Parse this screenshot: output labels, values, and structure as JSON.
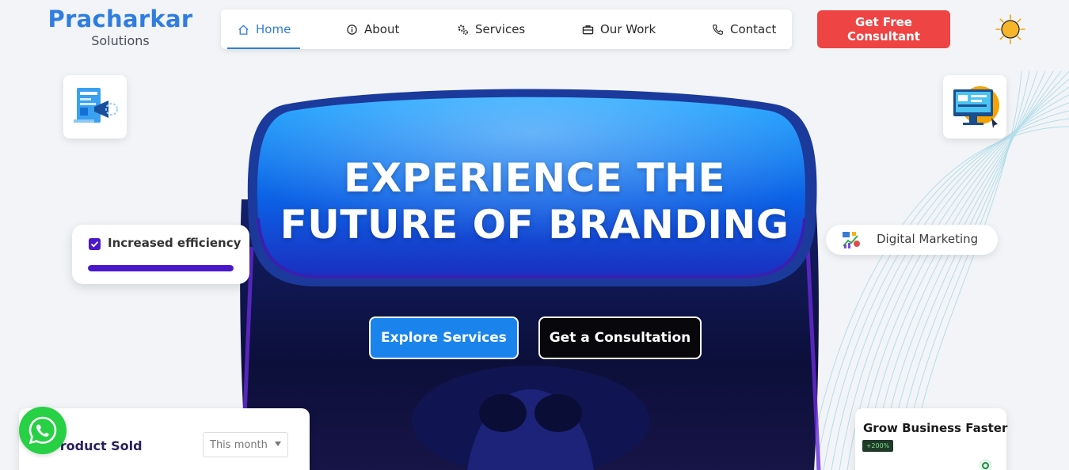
{
  "brand": {
    "name": "Pracharkar",
    "tagline": "Solutions"
  },
  "nav": {
    "items": [
      {
        "label": "Home",
        "icon": "home-icon",
        "active": true
      },
      {
        "label": "About",
        "icon": "info-icon"
      },
      {
        "label": "Services",
        "icon": "gears-icon"
      },
      {
        "label": "Our Work",
        "icon": "briefcase-icon"
      },
      {
        "label": "Contact",
        "icon": "phone-icon"
      }
    ],
    "cta_label": "Get Free Consultant",
    "theme_icon": "sun-icon"
  },
  "hero": {
    "title_line1": "EXPERIENCE THE",
    "title_line2": "FUTURE OF BRANDING",
    "primary_cta": "Explore Services",
    "secondary_cta": "Get a Consultation"
  },
  "cards": {
    "efficiency": {
      "label": "Increased efficiency",
      "progress": 1.0
    },
    "digital_marketing": {
      "label": "Digital Marketing"
    },
    "product_sold": {
      "title": "Product Sold",
      "period": "This month"
    },
    "grow": {
      "title": "Grow Business Faster",
      "badge": "+200%"
    }
  },
  "colors": {
    "brand_blue": "#2f7de1",
    "cta_red": "#ee4444",
    "accent_purple": "#4b18c9",
    "whatsapp_green": "#27d045"
  }
}
